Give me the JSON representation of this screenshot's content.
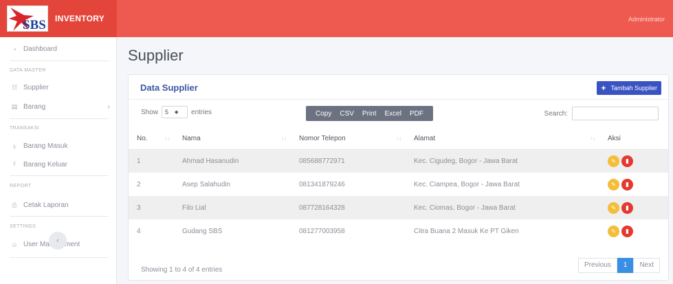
{
  "header": {
    "brand": "INVENTORY",
    "logo_text": "SBS",
    "user": "Administrator"
  },
  "sidebar": {
    "dashboard": "Dashboard",
    "section_master": "DATA MASTER",
    "supplier": "Supplier",
    "barang": "Barang",
    "section_transaksi": "TRANSAKSI",
    "barang_masuk": "Barang Masuk",
    "barang_keluar": "Barang Keluar",
    "section_report": "REPORT",
    "cetak_laporan": "Cetak Laporan",
    "section_settings": "SETTINGS",
    "user_management": "User Management",
    "collapse": "‹"
  },
  "page": {
    "title": "Supplier"
  },
  "card": {
    "title": "Data Supplier",
    "add_label": "Tambah Supplier",
    "show_label": "Show",
    "page_len": "5",
    "entries_label": "entries",
    "export": [
      "Copy",
      "CSV",
      "Print",
      "Excel",
      "PDF"
    ],
    "search_label": "Search:"
  },
  "table": {
    "columns": [
      "No.",
      "Nama",
      "Nomor Telepon",
      "Alamat",
      "Aksi"
    ],
    "rows": [
      [
        "1",
        "Ahmad Hasanudin",
        "085688772971",
        "Kec. Cigudeg, Bogor - Jawa Barat"
      ],
      [
        "2",
        "Asep Salahudin",
        "081341879246",
        "Kec. Ciampea, Bogor - Jawa Barat"
      ],
      [
        "3",
        "Filo Lial",
        "087728164328",
        "Kec. Ciomas, Bogor - Jawa Barat"
      ],
      [
        "4",
        "Gudang SBS",
        "081277003958",
        "Citra Buana 2 Masuk Ke PT Giken"
      ]
    ]
  },
  "footer": {
    "info": "Showing 1 to 4 of 4 entries",
    "previous": "Previous",
    "page": "1",
    "next": "Next"
  },
  "colors": {
    "topbar": "#ee5a4f",
    "primary": "#3a53c2",
    "edit": "#f4be3a",
    "delete": "#e5382e"
  }
}
